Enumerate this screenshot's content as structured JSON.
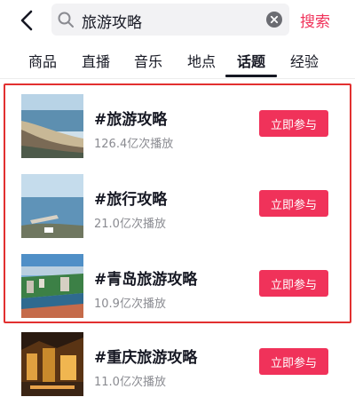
{
  "search": {
    "query": "旅游攻略",
    "submit_label": "搜索"
  },
  "tabs": [
    {
      "label": "商品",
      "active": false
    },
    {
      "label": "直播",
      "active": false
    },
    {
      "label": "音乐",
      "active": false
    },
    {
      "label": "地点",
      "active": false
    },
    {
      "label": "话题",
      "active": true
    },
    {
      "label": "经验",
      "active": false
    }
  ],
  "topics": [
    {
      "title": "#旅游攻略",
      "plays": "126.4亿次播放",
      "button": "立即参与",
      "thumbnail": "coast-beach-photo"
    },
    {
      "title": "#旅行攻略",
      "plays": "21.0亿次播放",
      "button": "立即参与",
      "thumbnail": "sea-pier-photo"
    },
    {
      "title": "#青岛旅游攻略",
      "plays": "10.9亿次播放",
      "button": "立即参与",
      "thumbnail": "qingdao-city-photo"
    },
    {
      "title": "#重庆旅游攻略",
      "plays": "11.0亿次播放",
      "button": "立即参与",
      "thumbnail": "chongqing-night-photo"
    }
  ],
  "colors": {
    "accent": "#f0325a",
    "highlight_border": "#e23030",
    "text": "#161823",
    "secondary_text": "#8a8b91",
    "search_bg": "#f2f2f4"
  },
  "icons": [
    "back-arrow-icon",
    "search-icon",
    "clear-icon"
  ]
}
